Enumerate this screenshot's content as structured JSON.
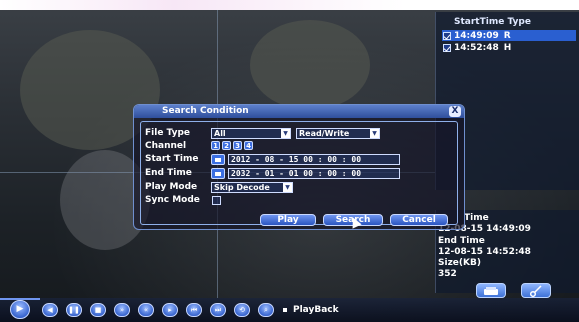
{
  "dialog": {
    "title": "Search Condition",
    "close_glyph": "X",
    "file_type_label": "File Type",
    "file_type_value": "All",
    "rw_value": "Read/Write",
    "channel_label": "Channel",
    "channels": [
      "1",
      "2",
      "3",
      "4"
    ],
    "start_time_label": "Start Time",
    "start_time_value": "2012 - 08 - 15  00 : 00 : 00",
    "end_time_label": "End Time",
    "end_time_value": "2032 - 01 - 01  00 : 00 : 00",
    "play_mode_label": "Play Mode",
    "play_mode_value": "Skip Decode",
    "sync_mode_label": "Sync Mode",
    "play_label": "Play",
    "search_label": "Search",
    "cancel_label": "Cancel"
  },
  "file_list": {
    "header": "StartTime Type",
    "rows": [
      {
        "time": "14:49:09",
        "type": "R"
      },
      {
        "time": "14:52:48",
        "type": "H"
      }
    ]
  },
  "info": {
    "start_label": "Time",
    "start_value": "12-08-15 14:49:09",
    "end_label": "End Time",
    "end_value": "12-08-15 14:52:48",
    "size_label": "Size(KB)",
    "size_value": "352"
  },
  "toolbar": {
    "label": "PlayBack"
  },
  "colors": {
    "accent": "#3d6ee0",
    "selected_row": "#2a5fd0",
    "dialog_border": "#8fb0ea"
  }
}
